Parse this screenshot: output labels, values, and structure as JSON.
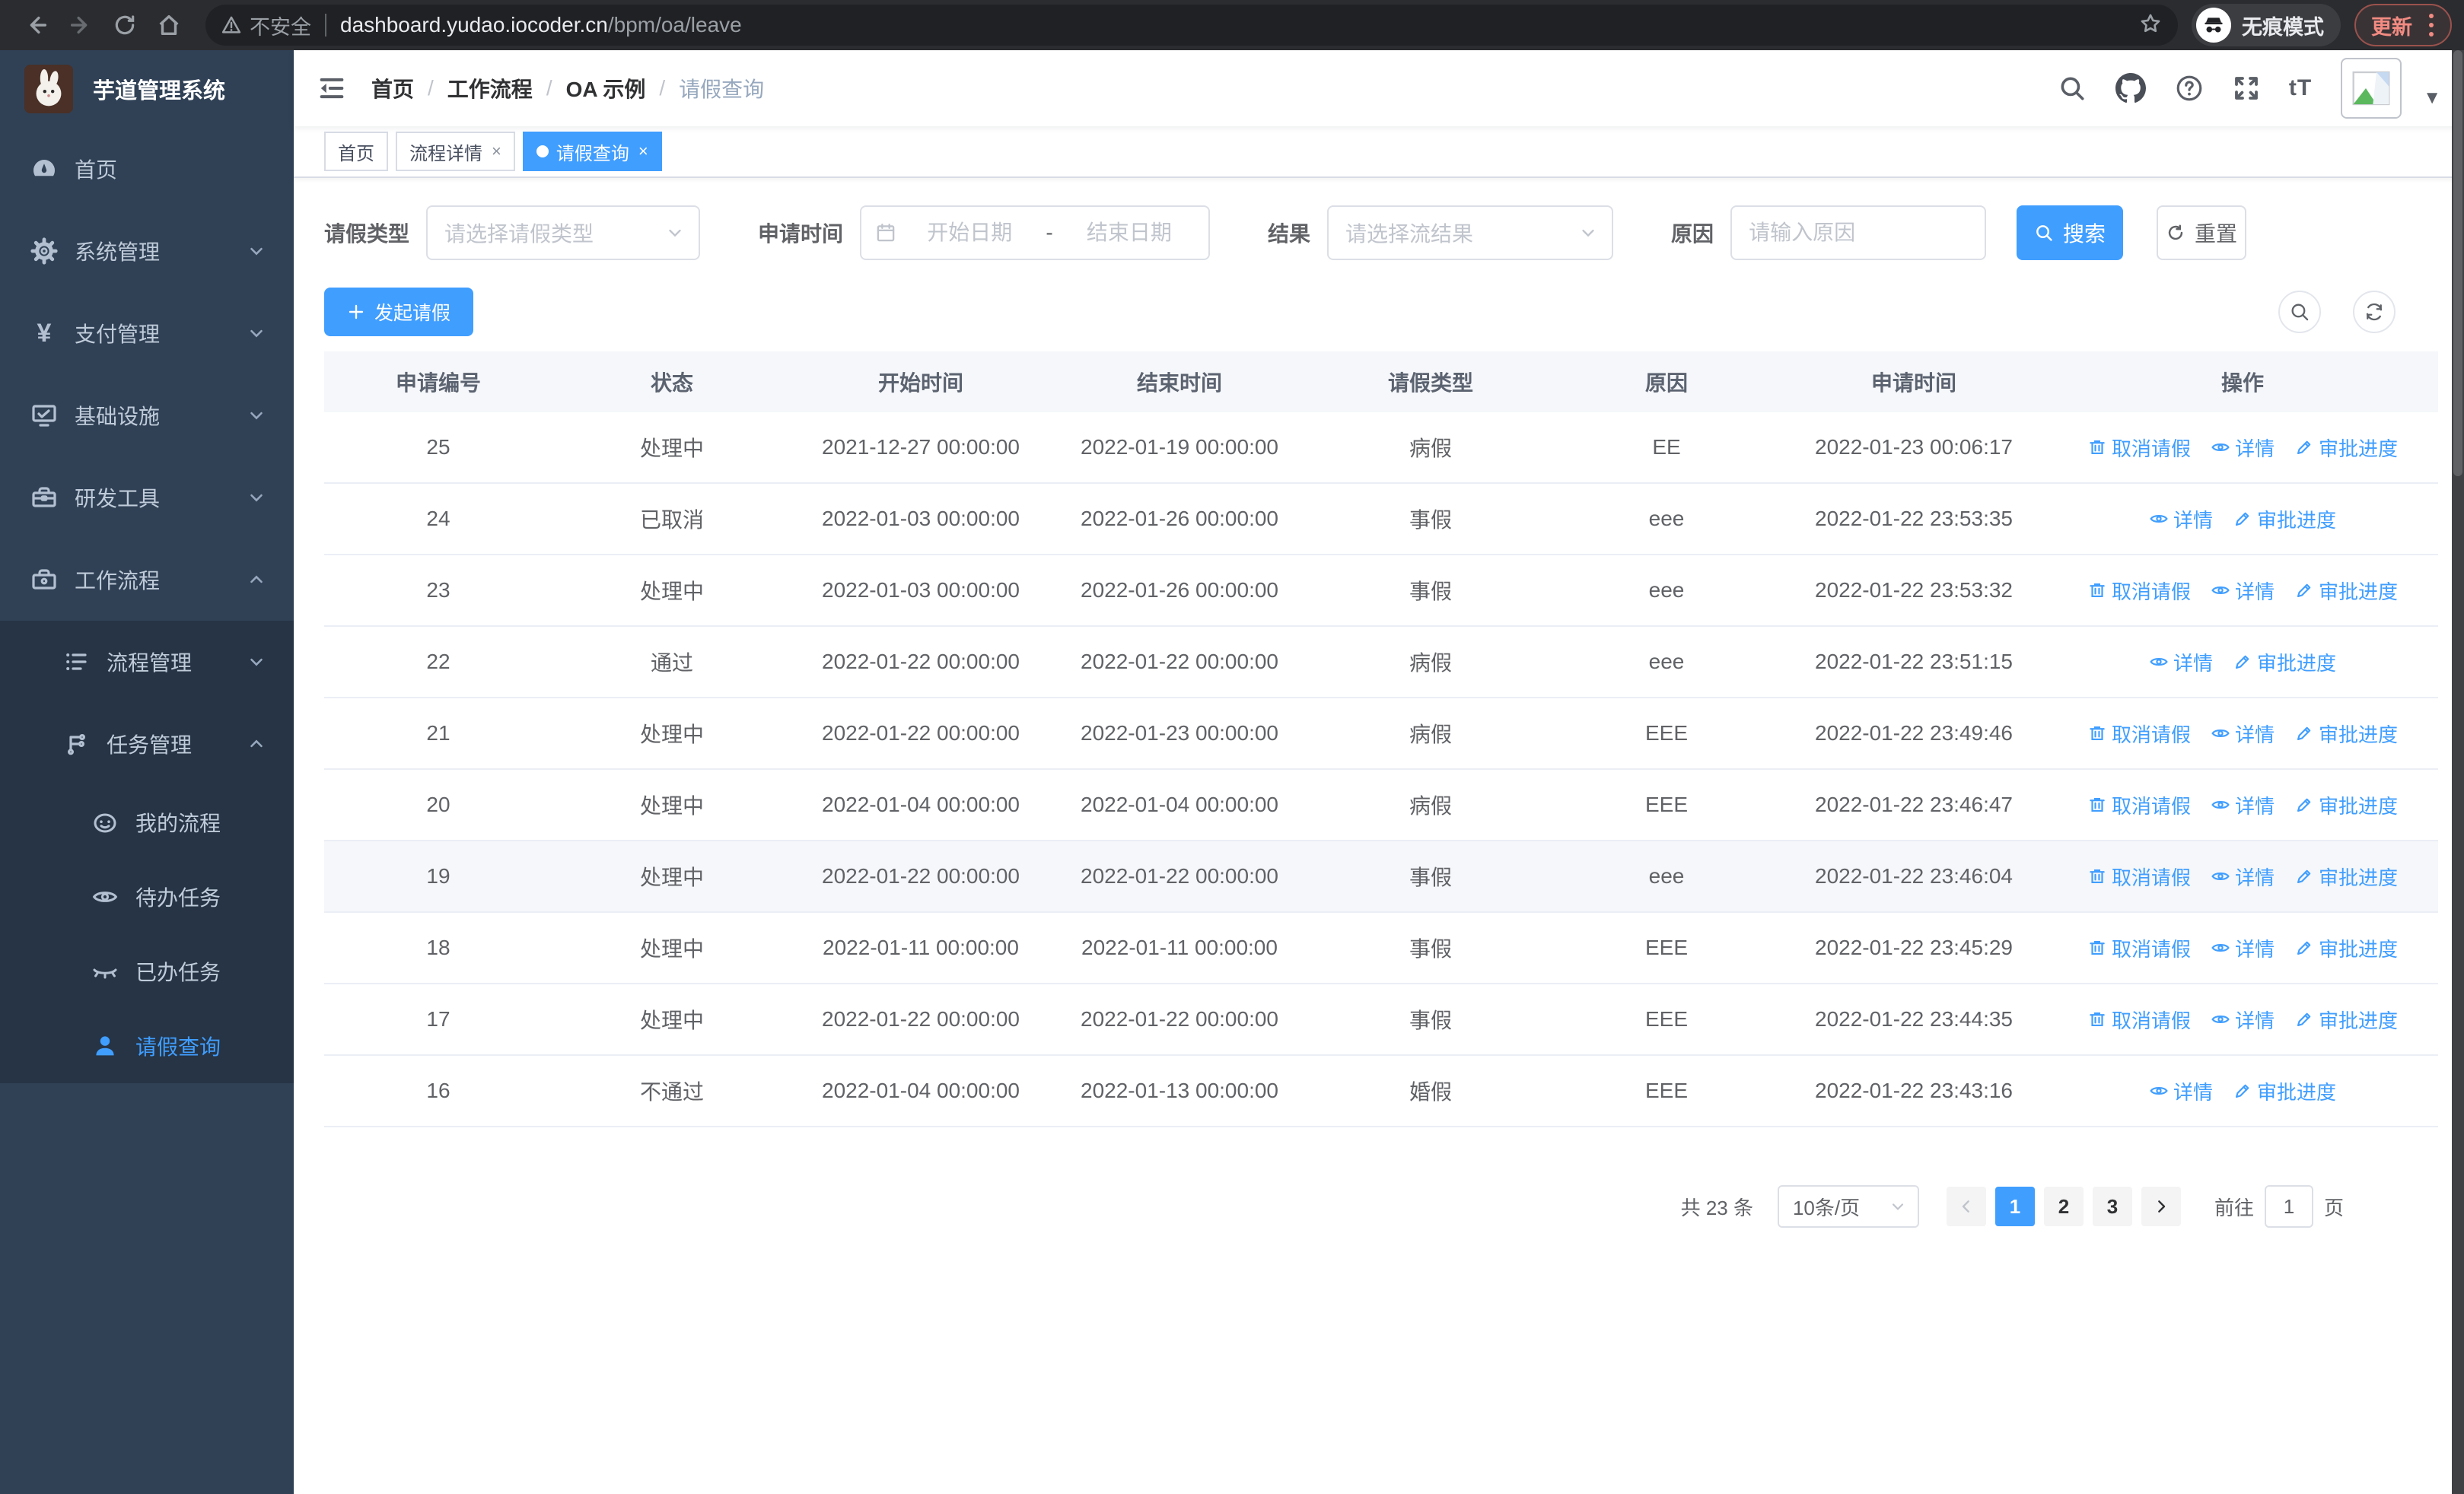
{
  "browser": {
    "security_label": "不安全",
    "url_host": "dashboard.yudao.iocoder.cn",
    "url_path": "/bpm/oa/leave",
    "incognito_label": "无痕模式",
    "update_label": "更新"
  },
  "sidebar": {
    "title": "芋道管理系统",
    "items": [
      {
        "label": "首页"
      },
      {
        "label": "系统管理"
      },
      {
        "label": "支付管理"
      },
      {
        "label": "基础设施"
      },
      {
        "label": "研发工具"
      },
      {
        "label": "工作流程"
      }
    ],
    "submenu": [
      {
        "label": "流程管理"
      },
      {
        "label": "任务管理"
      }
    ],
    "tasks": [
      {
        "label": "我的流程"
      },
      {
        "label": "待办任务"
      },
      {
        "label": "已办任务"
      },
      {
        "label": "请假查询"
      }
    ]
  },
  "navbar": {
    "separator": "/",
    "breadcrumb": [
      "首页",
      "工作流程",
      "OA 示例",
      "请假查询"
    ]
  },
  "tabs": [
    {
      "label": "首页"
    },
    {
      "label": "流程详情"
    },
    {
      "label": "请假查询"
    }
  ],
  "filters": {
    "type_label": "请假类型",
    "type_placeholder": "请选择请假类型",
    "time_label": "申请时间",
    "time_start_placeholder": "开始日期",
    "time_separator": "-",
    "time_end_placeholder": "结束日期",
    "result_label": "结果",
    "result_placeholder": "请选择流结果",
    "reason_label": "原因",
    "reason_placeholder": "请输入原因",
    "search_label": "搜索",
    "reset_label": "重置"
  },
  "toolbar": {
    "create_label": "发起请假"
  },
  "table": {
    "columns": [
      "申请编号",
      "状态",
      "开始时间",
      "结束时间",
      "请假类型",
      "原因",
      "申请时间",
      "操作"
    ],
    "actions": {
      "cancel": "取消请假",
      "detail": "详情",
      "progress": "审批进度"
    },
    "rows": [
      {
        "id": "25",
        "status": "处理中",
        "start": "2021-12-27 00:00:00",
        "end": "2022-01-19 00:00:00",
        "type": "病假",
        "reason": "EE",
        "applyTime": "2022-01-23 00:06:17",
        "can_cancel": true,
        "highlighted": false
      },
      {
        "id": "24",
        "status": "已取消",
        "start": "2022-01-03 00:00:00",
        "end": "2022-01-26 00:00:00",
        "type": "事假",
        "reason": "eee",
        "applyTime": "2022-01-22 23:53:35",
        "can_cancel": false,
        "highlighted": false
      },
      {
        "id": "23",
        "status": "处理中",
        "start": "2022-01-03 00:00:00",
        "end": "2022-01-26 00:00:00",
        "type": "事假",
        "reason": "eee",
        "applyTime": "2022-01-22 23:53:32",
        "can_cancel": true,
        "highlighted": false
      },
      {
        "id": "22",
        "status": "通过",
        "start": "2022-01-22 00:00:00",
        "end": "2022-01-22 00:00:00",
        "type": "病假",
        "reason": "eee",
        "applyTime": "2022-01-22 23:51:15",
        "can_cancel": false,
        "highlighted": false
      },
      {
        "id": "21",
        "status": "处理中",
        "start": "2022-01-22 00:00:00",
        "end": "2022-01-23 00:00:00",
        "type": "病假",
        "reason": "EEE",
        "applyTime": "2022-01-22 23:49:46",
        "can_cancel": true,
        "highlighted": false
      },
      {
        "id": "20",
        "status": "处理中",
        "start": "2022-01-04 00:00:00",
        "end": "2022-01-04 00:00:00",
        "type": "病假",
        "reason": "EEE",
        "applyTime": "2022-01-22 23:46:47",
        "can_cancel": true,
        "highlighted": false
      },
      {
        "id": "19",
        "status": "处理中",
        "start": "2022-01-22 00:00:00",
        "end": "2022-01-22 00:00:00",
        "type": "事假",
        "reason": "eee",
        "applyTime": "2022-01-22 23:46:04",
        "can_cancel": true,
        "highlighted": true
      },
      {
        "id": "18",
        "status": "处理中",
        "start": "2022-01-11 00:00:00",
        "end": "2022-01-11 00:00:00",
        "type": "事假",
        "reason": "EEE",
        "applyTime": "2022-01-22 23:45:29",
        "can_cancel": true,
        "highlighted": false
      },
      {
        "id": "17",
        "status": "处理中",
        "start": "2022-01-22 00:00:00",
        "end": "2022-01-22 00:00:00",
        "type": "事假",
        "reason": "EEE",
        "applyTime": "2022-01-22 23:44:35",
        "can_cancel": true,
        "highlighted": false
      },
      {
        "id": "16",
        "status": "不通过",
        "start": "2022-01-04 00:00:00",
        "end": "2022-01-13 00:00:00",
        "type": "婚假",
        "reason": "EEE",
        "applyTime": "2022-01-22 23:43:16",
        "can_cancel": false,
        "highlighted": false
      }
    ]
  },
  "pagination": {
    "total_label": "共 23 条",
    "page_size": "10条/页",
    "pages": [
      "1",
      "2",
      "3"
    ],
    "goto_label": "前往",
    "goto_value": "1",
    "page_unit": "页"
  },
  "colors": {
    "accent": "#409eff",
    "sidebar_bg": "#304156",
    "submenu_bg": "#263445"
  }
}
